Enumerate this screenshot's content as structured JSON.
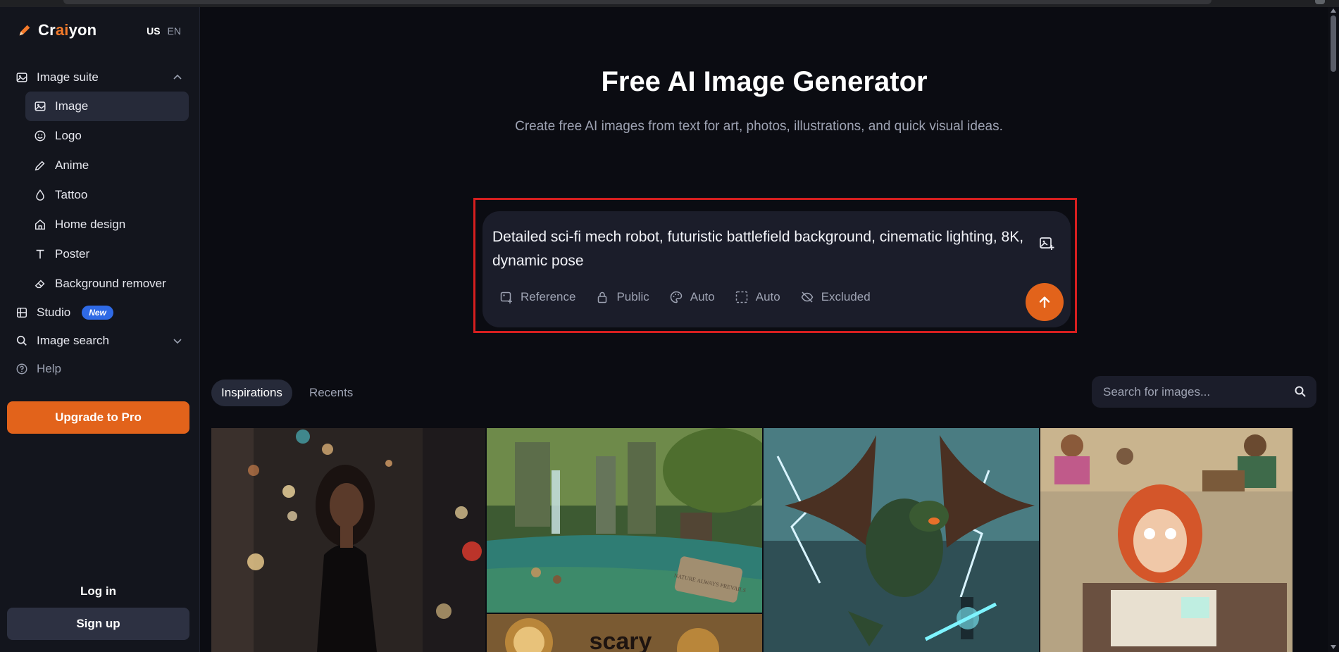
{
  "brand": {
    "name_prefix": "Cr",
    "name_accent": "ai",
    "name_suffix": "yon",
    "accent_color": "#f47a2a"
  },
  "language": {
    "region": "US",
    "code": "EN"
  },
  "sidebar": {
    "group_image_suite": "Image suite",
    "items": [
      {
        "label": "Image",
        "icon": "image-icon",
        "active": true
      },
      {
        "label": "Logo",
        "icon": "smiley-icon"
      },
      {
        "label": "Anime",
        "icon": "pencil-icon"
      },
      {
        "label": "Tattoo",
        "icon": "drop-icon"
      },
      {
        "label": "Home design",
        "icon": "home-icon"
      },
      {
        "label": "Poster",
        "icon": "text-icon"
      },
      {
        "label": "Background remover",
        "icon": "eraser-icon"
      }
    ],
    "studio": "Studio",
    "studio_badge": "New",
    "image_search": "Image search",
    "help": "Help",
    "upgrade": "Upgrade to Pro",
    "login": "Log in",
    "signup": "Sign up"
  },
  "hero": {
    "title": "Free AI Image Generator",
    "subtitle": "Create free AI images from text for art, photos, illustrations, and quick visual ideas."
  },
  "prompt": {
    "text": "Detailed sci-fi mech robot, futuristic battlefield background, cinematic lighting, 8K, dynamic pose",
    "options": {
      "reference": "Reference",
      "visibility": "Public",
      "style": "Auto",
      "ratio": "Auto",
      "negative": "Excluded"
    }
  },
  "tabs": {
    "inspirations": "Inspirations",
    "recents": "Recents"
  },
  "search": {
    "placeholder": "Search for images..."
  },
  "gallery": {
    "tiles": [
      "woman-city-night-photo",
      "jungle-ruins-waterfall-painting",
      "cartoon-scary-sign",
      "dragon-lightning-knight",
      "classroom-exam-comic"
    ],
    "stone_sign_text": "NATURE ALWAYS PREVAILS",
    "cartoon_text": "scary"
  },
  "colors": {
    "accent": "#e2631b",
    "outline": "#d71f1f",
    "badge": "#2f6ae6"
  }
}
